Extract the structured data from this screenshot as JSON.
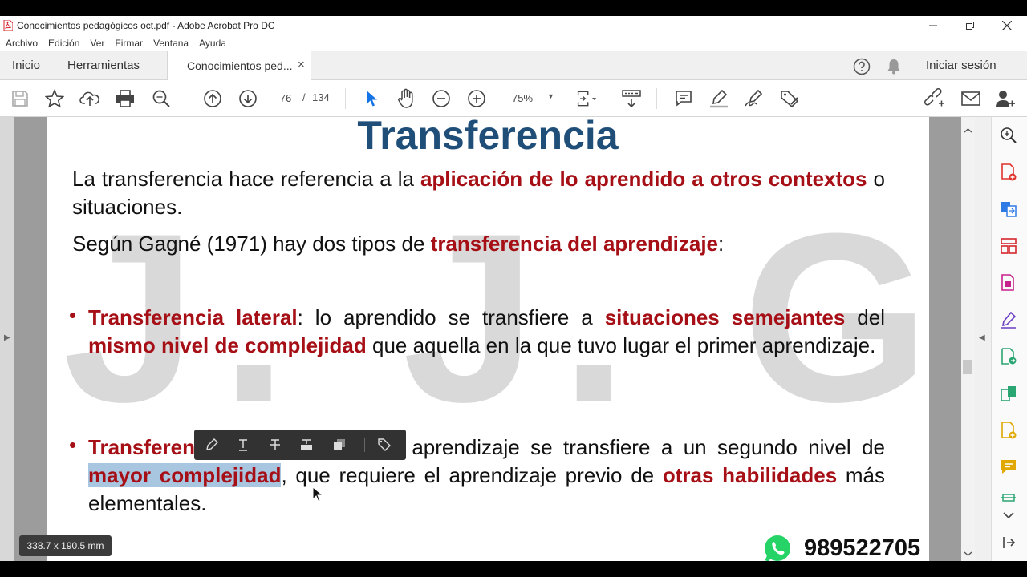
{
  "window": {
    "title": "Conocimientos pedagógicos oct.pdf - Adobe Acrobat Pro DC"
  },
  "menu": [
    "Archivo",
    "Edición",
    "Ver",
    "Firmar",
    "Ventana",
    "Ayuda"
  ],
  "tabs": {
    "home": "Inicio",
    "tools": "Herramientas",
    "document": "Conocimientos ped...",
    "close": "×"
  },
  "header": {
    "signin": "Iniciar sesión"
  },
  "toolbar": {
    "current_page": "76",
    "page_separator": "/",
    "total_pages": "134",
    "zoom": "75%"
  },
  "slide": {
    "title": "Transferencia",
    "watermark": "J. J. G. G.",
    "p1_a": "La transferencia hace referencia a la ",
    "p1_red": "aplicación de lo aprendido a otros contextos",
    "p1_b": " o situaciones.",
    "p2_a": "Según Gagné (1971) hay dos tipos de ",
    "p2_red": "transferencia del aprendizaje",
    "p2_b": ":",
    "b1_red1": "Transferencia lateral",
    "b1_a": ": lo aprendido se transfiere a ",
    "b1_red2": "situaciones semejantes",
    "b1_b": " del ",
    "b1_red3": "mismo nivel de complejidad",
    "b1_c": " que aquella en la que tuvo lugar el primer aprendizaje.",
    "b2_red1": "Transferen",
    "b2_a": "cia vertical: el primer aprendizaje se transfiere a un segundo nivel de ",
    "b2_red2": "mayor complejidad",
    "b2_b": ", que requiere el aprendizaje previo de ",
    "b2_red3": "otras habilidades",
    "b2_c": " más elementales.",
    "bullet": "•"
  },
  "status": {
    "page_size": "338.7 x 190.5 mm"
  },
  "overlay": {
    "phone": "989522705"
  },
  "colors": {
    "title_blue": "#1f4e79",
    "emphasis_red": "#a50f15",
    "selection": "#a9c6e0",
    "select_tool_blue": "#1473e6"
  }
}
